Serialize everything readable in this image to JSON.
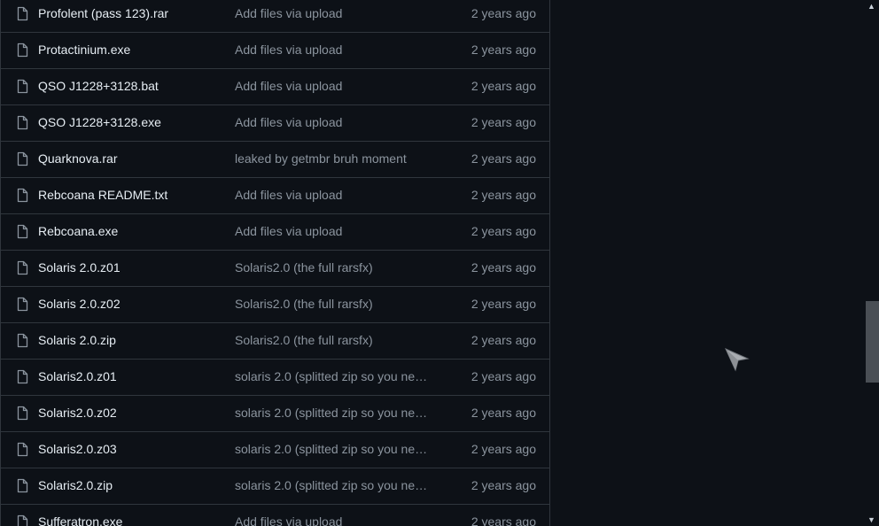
{
  "file_list": {
    "rows": [
      {
        "name": "Profolent (pass 123).rar",
        "commit": "Add files via upload",
        "age": "2 years ago"
      },
      {
        "name": "Protactinium.exe",
        "commit": "Add files via upload",
        "age": "2 years ago"
      },
      {
        "name": "QSO J1228+3128.bat",
        "commit": "Add files via upload",
        "age": "2 years ago"
      },
      {
        "name": "QSO J1228+3128.exe",
        "commit": "Add files via upload",
        "age": "2 years ago"
      },
      {
        "name": "Quarknova.rar",
        "commit": "leaked by getmbr bruh moment",
        "age": "2 years ago"
      },
      {
        "name": "Rebcoana README.txt",
        "commit": "Add files via upload",
        "age": "2 years ago"
      },
      {
        "name": "Rebcoana.exe",
        "commit": "Add files via upload",
        "age": "2 years ago"
      },
      {
        "name": "Solaris 2.0.z01",
        "commit": "Solaris2.0 (the full rarsfx)",
        "age": "2 years ago"
      },
      {
        "name": "Solaris 2.0.z02",
        "commit": "Solaris2.0 (the full rarsfx)",
        "age": "2 years ago"
      },
      {
        "name": "Solaris 2.0.zip",
        "commit": "Solaris2.0 (the full rarsfx)",
        "age": "2 years ago"
      },
      {
        "name": "Solaris2.0.z01",
        "commit": "solaris 2.0 (splitted zip so you nee…",
        "age": "2 years ago"
      },
      {
        "name": "Solaris2.0.z02",
        "commit": "solaris 2.0 (splitted zip so you nee…",
        "age": "2 years ago"
      },
      {
        "name": "Solaris2.0.z03",
        "commit": "solaris 2.0 (splitted zip so you nee…",
        "age": "2 years ago"
      },
      {
        "name": "Solaris2.0.zip",
        "commit": "solaris 2.0 (splitted zip so you nee…",
        "age": "2 years ago"
      },
      {
        "name": "Sufferatron.exe",
        "commit": "Add files via upload",
        "age": "2 years ago"
      }
    ]
  },
  "scrollbar": {
    "up_arrow": "▲",
    "down_arrow": "▼",
    "position_fraction": 0.6
  },
  "icons": {
    "file": "file-icon",
    "cursor": "mouse-cursor-icon"
  },
  "colors": {
    "background": "#0d1117",
    "border": "#30363d",
    "text_primary": "#e6edf3",
    "text_muted": "#8b949e"
  }
}
